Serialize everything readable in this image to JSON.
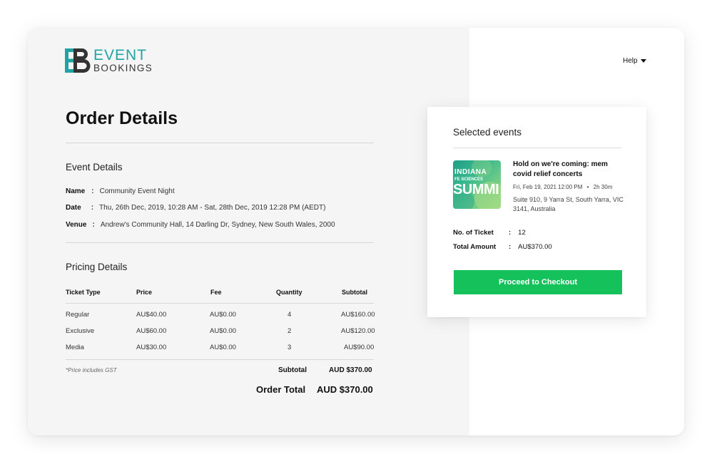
{
  "brand": {
    "line1": "EVENT",
    "line2": "BOOKINGS",
    "color_primary": "#1fa3a3",
    "color_dark": "#333333"
  },
  "page_title": "Order Details",
  "help_label": "Help",
  "event_details": {
    "title": "Event Details",
    "name_label": "Name",
    "name_value": "Community Event Night",
    "date_label": "Date",
    "date_value": "Thu, 26th Dec, 2019, 10:28 AM - Sat, 28th Dec, 2019 12:28 PM (AEDT)",
    "venue_label": "Venue",
    "venue_value": "Andrew's Community Hall, 14 Darling Dr, Sydney, New South Wales, 2000",
    "separator": ":"
  },
  "pricing": {
    "title": "Pricing Details",
    "headers": [
      "Ticket Type",
      "Price",
      "Fee",
      "Quantity",
      "Subtotal"
    ],
    "rows": [
      {
        "type": "Regular",
        "price": "AU$40.00",
        "fee": "AU$0.00",
        "qty": "4",
        "subtotal": "AU$160.00"
      },
      {
        "type": "Exclusive",
        "price": "AU$60.00",
        "fee": "AU$0.00",
        "qty": "2",
        "subtotal": "AU$120.00"
      },
      {
        "type": "Media",
        "price": "AU$30.00",
        "fee": "AU$0.00",
        "qty": "3",
        "subtotal": "AU$90.00"
      }
    ],
    "gst_note": "*Price includes GST",
    "subtotal_label": "Subtotal",
    "subtotal_value": "AUD $370.00",
    "total_label": "Order Total",
    "total_value": "AUD $370.00"
  },
  "selected": {
    "title": "Selected events",
    "event_name": "Hold on we're coming: mem covid relief concerts",
    "event_date": "Fri, Feb 19, 2021 12:00 PM",
    "event_duration": "2h 30m",
    "event_address": "Suite 910, 9 Yarra St, South Yarra, VIC 3141, Australia",
    "thumb_text1": "INDIANA",
    "thumb_text2": "FE SCIENCES",
    "thumb_text3": "SUMMI",
    "tickets_label": "No. of Ticket",
    "tickets_value": "12",
    "amount_label": "Total Amount",
    "amount_value": "AU$370.00",
    "separator": ":",
    "checkout_label": "Proceed to Checkout",
    "checkout_color": "#14c15a"
  }
}
